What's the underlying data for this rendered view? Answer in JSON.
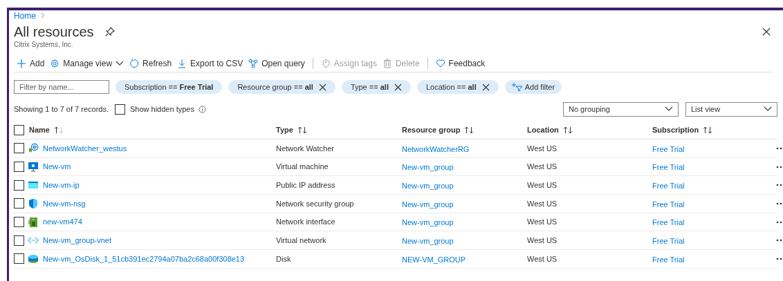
{
  "breadcrumb": [
    {
      "label": "Home"
    }
  ],
  "page": {
    "title": "All resources",
    "subtitle": "Citrix Systems, Inc."
  },
  "toolbar": [
    {
      "kind": "add",
      "label": "Add",
      "disabled": false
    },
    {
      "kind": "manage",
      "label": "Manage view",
      "disabled": false
    },
    {
      "kind": "refresh",
      "label": "Refresh",
      "disabled": false
    },
    {
      "kind": "export",
      "label": "Export to CSV",
      "disabled": false
    },
    {
      "kind": "query",
      "label": "Open query",
      "disabled": false
    },
    {
      "kind": "tags",
      "label": "Assign tags",
      "disabled": true
    },
    {
      "kind": "delete",
      "label": "Delete",
      "disabled": true
    },
    {
      "kind": "feedback",
      "label": "Feedback",
      "disabled": false
    }
  ],
  "filter": {
    "placeholder": "Filter by name..."
  },
  "filters": [
    {
      "label": "Subscription == **Free Trial**",
      "removable": false
    },
    {
      "label": "Resource group == **all**",
      "removable": true
    },
    {
      "label": "Type == **all**",
      "removable": true
    },
    {
      "label": "Location == **all**",
      "removable": true
    }
  ],
  "add_filter": "Add filter",
  "records": "Showing 1 to 7 of 7 records.",
  "show_hidden": {
    "label": "Show hidden types",
    "checked": false
  },
  "grouping": "No grouping",
  "view": "List view",
  "table": {
    "columns": [
      {
        "label": "Name",
        "sorted": true
      },
      {
        "label": "Type",
        "sorted": false
      },
      {
        "label": "Resource group",
        "sorted": false
      },
      {
        "label": "Location",
        "sorted": false
      },
      {
        "label": "Subscription",
        "sorted": false
      }
    ],
    "select_all_checked": false,
    "rows": [
      {
        "kind": "watcher",
        "name": "NetworkWatcher_westus",
        "type": "Network Watcher",
        "group": "NetworkWatcherRG",
        "location": "West US",
        "subscription": "Free Trial",
        "checked": false
      },
      {
        "kind": "vm",
        "name": "New-vm",
        "type": "Virtual machine",
        "group": "New-vm_group",
        "location": "West US",
        "subscription": "Free Trial",
        "checked": false
      },
      {
        "kind": "ip",
        "name": "New-vm-ip",
        "type": "Public IP address",
        "group": "New-vm_group",
        "location": "West US",
        "subscription": "Free Trial",
        "checked": false
      },
      {
        "kind": "nsg",
        "name": "New-vm-nsg",
        "type": "Network security group",
        "group": "New-vm_group",
        "location": "West US",
        "subscription": "Free Trial",
        "checked": false
      },
      {
        "kind": "nic",
        "name": "new-vm474",
        "type": "Network interface",
        "group": "New-vm_group",
        "location": "West US",
        "subscription": "Free Trial",
        "checked": false
      },
      {
        "kind": "vnet",
        "name": "New-vm_group-vnet",
        "type": "Virtual network",
        "group": "New-vm_group",
        "location": "West US",
        "subscription": "Free Trial",
        "checked": false
      },
      {
        "kind": "disk",
        "name": "New-vm_OsDisk_1_51cb391ec2794a07ba2c68a00f308e13",
        "type": "Disk",
        "group": "NEW-VM_GROUP",
        "location": "West US",
        "subscription": "Free Trial",
        "checked": false
      }
    ]
  }
}
